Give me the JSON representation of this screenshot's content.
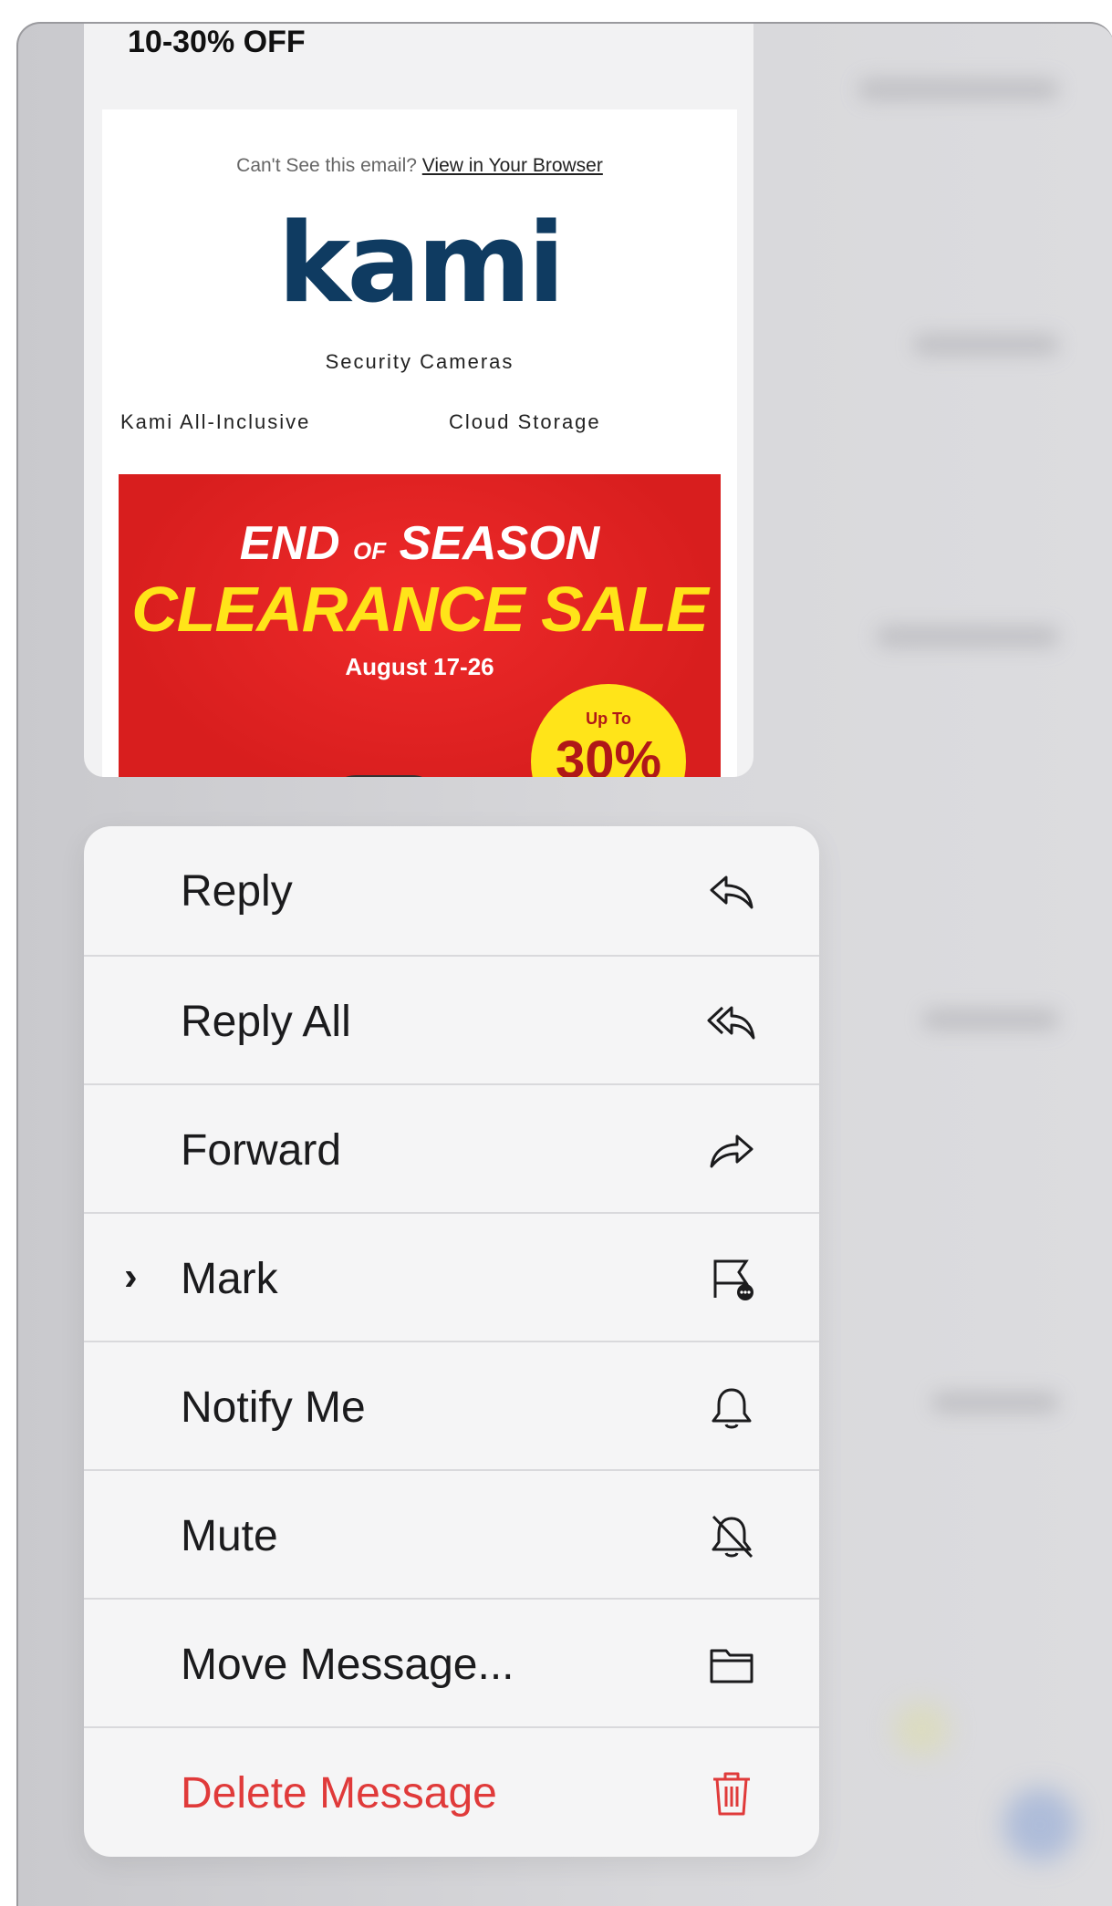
{
  "preview": {
    "header_text": "10-30% OFF",
    "cant_see_text": "Can't See this email?",
    "view_browser_link": "View in Your Browser",
    "logo_text": "kami",
    "tagline": "Security Cameras",
    "nav_links": [
      "Kami All-Inclusive",
      "Cloud Storage"
    ],
    "banner": {
      "line1_a": "END",
      "line1_of": "OF",
      "line1_b": "SEASON",
      "line2": "CLEARANCE SALE",
      "dates": "August 17-26",
      "badge_top": "Up To",
      "badge_value": "30%"
    }
  },
  "menu": {
    "items": [
      {
        "label": "Reply",
        "icon": "reply-icon"
      },
      {
        "label": "Reply All",
        "icon": "reply-all-icon"
      },
      {
        "label": "Forward",
        "icon": "forward-icon"
      },
      {
        "label": "Mark",
        "icon": "flag-icon",
        "has_submenu": true
      },
      {
        "label": "Notify Me",
        "icon": "bell-icon"
      },
      {
        "label": "Mute",
        "icon": "bell-slash-icon"
      },
      {
        "label": "Move Message...",
        "icon": "folder-icon"
      },
      {
        "label": "Delete Message",
        "icon": "trash-icon",
        "destructive": true
      }
    ]
  },
  "colors": {
    "destructive": "#e03a3a",
    "brand_navy": "#0f3b61",
    "banner_red": "#d81e1e",
    "banner_yellow": "#ffe419"
  }
}
